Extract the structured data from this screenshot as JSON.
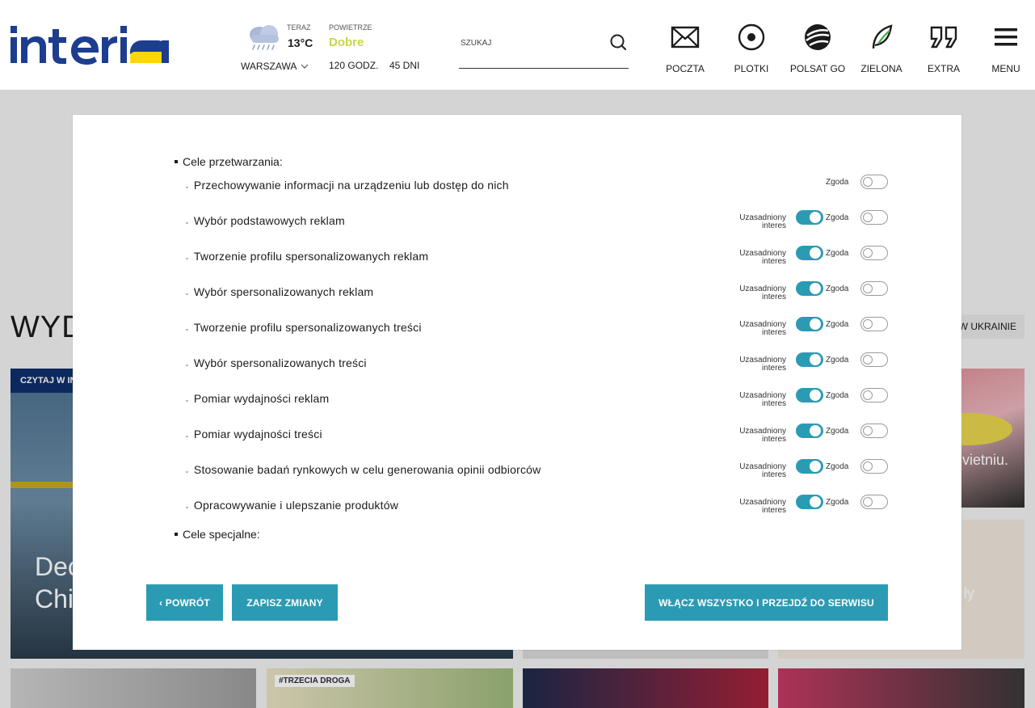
{
  "header": {
    "weather": {
      "now_label": "TERAZ",
      "temperature": "13°C",
      "city": "WARSZAWA",
      "air_label": "POWIETRZE",
      "air_value": "Dobre",
      "forecast_hours": "120 GODZ.",
      "forecast_days": "45 DNI"
    },
    "search": {
      "placeholder": "SZUKAJ"
    },
    "nav": [
      {
        "label": "POCZTA",
        "icon": "mail-icon"
      },
      {
        "label": "PLOTKI",
        "icon": "plotki-icon"
      },
      {
        "label": "POLSAT GO",
        "icon": "polsat-go-icon"
      },
      {
        "label": "ZIELONA",
        "icon": "leaf-icon"
      },
      {
        "label": "EXTRA",
        "icon": "quote-icon"
      },
      {
        "label": "MENU",
        "icon": "hamburger-icon"
      }
    ]
  },
  "background": {
    "section_title": "WYD",
    "tag_ukraine": "W UKRAINIE",
    "main_card_badge": "CZYTAJ W IN",
    "main_card_headline_line1": "Dec",
    "main_card_headline_line2": "Chi",
    "right_card_1_headline": "vietniu.",
    "right_card_2_headline": "ły",
    "bottom_tag_2": "#TRZECIA DROGA"
  },
  "consent": {
    "purposes_heading": "Cele przetwarzania:",
    "special_heading": "Cele specjalne:",
    "legit_interest_line1": "Uzasadniony",
    "legit_interest_line2": "interes",
    "consent_label": "Zgoda",
    "rows": [
      {
        "label": "Przechowywanie informacji na urządzeniu lub dostęp do nich",
        "has_legit": false,
        "legit_on": false,
        "consent_on": false
      },
      {
        "label": "Wybór podstawowych reklam",
        "has_legit": true,
        "legit_on": true,
        "consent_on": false
      },
      {
        "label": "Tworzenie profilu spersonalizowanych reklam",
        "has_legit": true,
        "legit_on": true,
        "consent_on": false
      },
      {
        "label": "Wybór spersonalizowanych reklam",
        "has_legit": true,
        "legit_on": true,
        "consent_on": false
      },
      {
        "label": "Tworzenie profilu spersonalizowanych treści",
        "has_legit": true,
        "legit_on": true,
        "consent_on": false
      },
      {
        "label": "Wybór spersonalizowanych treści",
        "has_legit": true,
        "legit_on": true,
        "consent_on": false
      },
      {
        "label": "Pomiar wydajności reklam",
        "has_legit": true,
        "legit_on": true,
        "consent_on": false
      },
      {
        "label": "Pomiar wydajności treści",
        "has_legit": true,
        "legit_on": true,
        "consent_on": false
      },
      {
        "label": "Stosowanie badań rynkowych w celu generowania opinii odbiorców",
        "has_legit": true,
        "legit_on": true,
        "consent_on": false
      },
      {
        "label": "Opracowywanie i ulepszanie produktów",
        "has_legit": true,
        "legit_on": true,
        "consent_on": false
      }
    ],
    "buttons": {
      "back": "‹ POWRÓT",
      "save": "ZAPISZ ZMIANY",
      "accept_all": "WŁĄCZ WSZYSTKO I PRZEJDŹ DO SERWISU"
    }
  },
  "colors": {
    "accent": "#2b9bb4",
    "logo_blue": "#1d3d8f",
    "logo_yellow": "#ffd60a",
    "air_good": "#c8d64a"
  }
}
